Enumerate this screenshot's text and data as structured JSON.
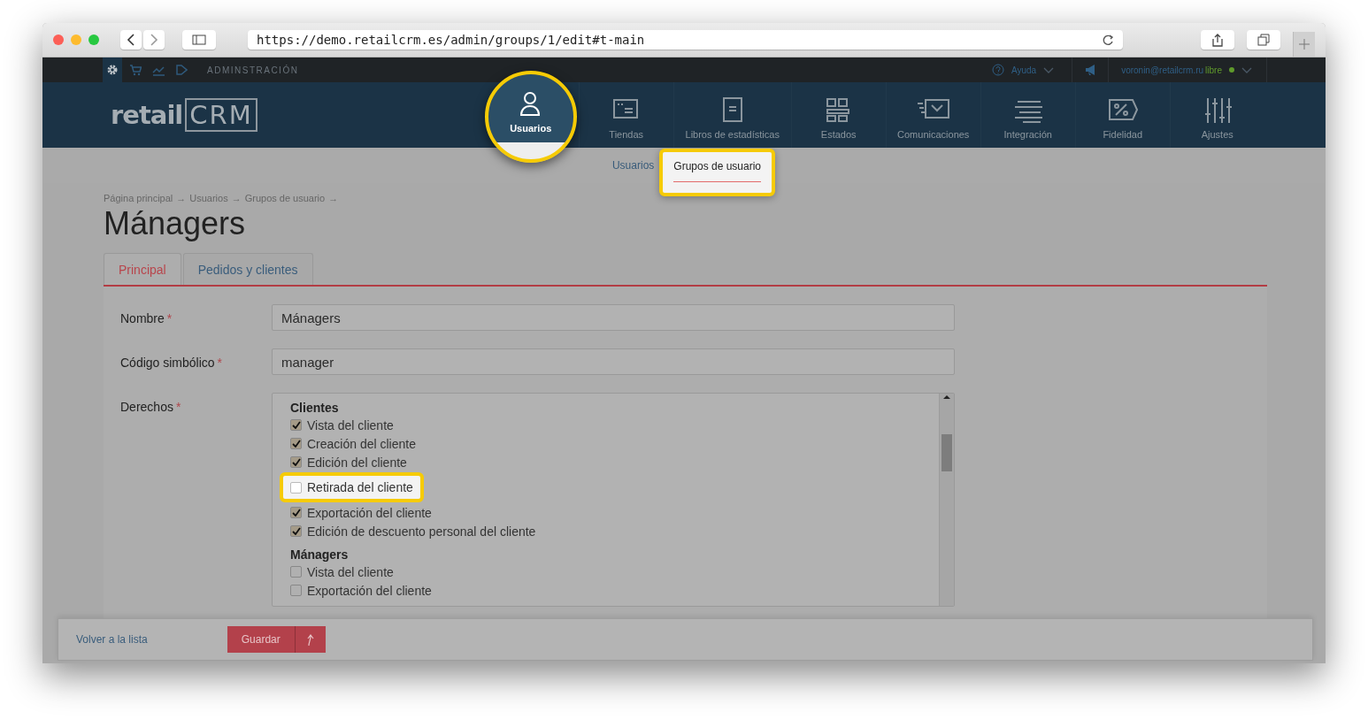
{
  "browser": {
    "url": "https://demo.retailcrm.es/admin/groups/1/edit#t-main"
  },
  "admin_bar": {
    "tools": [
      {
        "kind": "gear",
        "selected": true
      },
      {
        "kind": "cart",
        "selected": false
      },
      {
        "kind": "chart",
        "selected": false
      },
      {
        "kind": "play",
        "selected": false
      }
    ],
    "section": "ADMINSTRACIÓN",
    "help": "Ayuda",
    "user_email": "voronin@retailcrm.ru",
    "plan": "libre"
  },
  "logo": {
    "part_1": "retail",
    "part_2": "CRM"
  },
  "nav": [
    {
      "kind": "user",
      "label": "Usuarios",
      "selected": true,
      "highlighted": true
    },
    {
      "kind": "window",
      "label": "Tiendas",
      "selected": false,
      "highlighted": false
    },
    {
      "kind": "book",
      "label": "Libros de estadísticas",
      "selected": false,
      "highlighted": false
    },
    {
      "kind": "grid",
      "label": "Estados",
      "selected": false,
      "highlighted": false
    },
    {
      "kind": "mail",
      "label": "Comunicaciones",
      "selected": false,
      "highlighted": false
    },
    {
      "kind": "lines",
      "label": "Integración",
      "selected": false,
      "highlighted": false
    },
    {
      "kind": "percent",
      "label": "Fidelidad",
      "selected": false,
      "highlighted": false
    },
    {
      "kind": "sliders",
      "label": "Ajustes",
      "selected": false,
      "highlighted": false
    }
  ],
  "subnav": [
    {
      "label": "Usuarios",
      "selected": false,
      "highlighted": false
    },
    {
      "label": "Grupos de usuario",
      "selected": true,
      "highlighted": true
    }
  ],
  "breadcrumbs": [
    {
      "label": "Página principal",
      "separator": "→"
    },
    {
      "label": "Usuarios",
      "separator": "→"
    },
    {
      "label": "Grupos de usuario",
      "separator": "→"
    }
  ],
  "title": "Mánagers",
  "tabs": [
    {
      "label": "Principal",
      "selected": true
    },
    {
      "label": "Pedidos y clientes",
      "selected": false
    }
  ],
  "form": {
    "fields": [
      {
        "label": "Nombre",
        "required_mark": "*",
        "value": "Mánagers"
      },
      {
        "label": "Código simbólico",
        "required_mark": "*",
        "value": "manager"
      }
    ],
    "rights": {
      "label": "Derechos",
      "required_mark": "*",
      "groups": [
        {
          "title": "Clientes",
          "items": [
            {
              "label": "Vista del cliente",
              "checked": true,
              "highlighted": false
            },
            {
              "label": "Creación del cliente",
              "checked": true,
              "highlighted": false
            },
            {
              "label": "Edición del cliente",
              "checked": true,
              "highlighted": false
            },
            {
              "label": "Retirada del cliente",
              "checked": false,
              "highlighted": true
            },
            {
              "label": "Exportación del cliente",
              "checked": true,
              "highlighted": false
            },
            {
              "label": "Edición de descuento personal del cliente",
              "checked": true,
              "highlighted": false
            }
          ]
        },
        {
          "title": "Mánagers",
          "items": [
            {
              "label": "Vista del cliente",
              "checked": false,
              "highlighted": false
            },
            {
              "label": "Exportación del cliente",
              "checked": false,
              "highlighted": false
            }
          ]
        }
      ]
    }
  },
  "footer": {
    "back_link": "Volver a la lista",
    "save_button": "Guardar"
  }
}
